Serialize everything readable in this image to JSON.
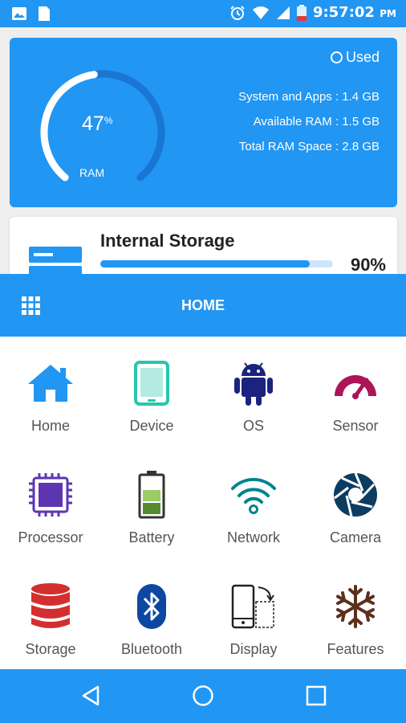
{
  "status_bar": {
    "time": "9:57:02",
    "ampm": "PM",
    "icons": [
      "image-icon",
      "document-icon",
      "alarm-icon",
      "wifi-icon",
      "signal-icon",
      "battery-charging-icon"
    ]
  },
  "ram": {
    "percent": "47",
    "percent_sign": "%",
    "label": "RAM",
    "used_fraction": 0.47,
    "legend": "Used",
    "system_apps": "System and Apps : 1.4 GB",
    "available": "Available RAM : 1.5 GB",
    "total": "Total RAM Space : 2.8 GB"
  },
  "storage": {
    "title": "Internal Storage",
    "percent_text": "90%",
    "fill_fraction": 0.9
  },
  "toolbar": {
    "title": "HOME",
    "menu_icon": "grid-icon"
  },
  "menu": {
    "items": [
      {
        "label": "Home",
        "icon": "home-icon",
        "color": "#2196f3"
      },
      {
        "label": "Device",
        "icon": "tablet-icon",
        "color": "#26c6b0"
      },
      {
        "label": "OS",
        "icon": "android-icon",
        "color": "#1a237e"
      },
      {
        "label": "Sensor",
        "icon": "gauge-icon",
        "color": "#ad1457"
      },
      {
        "label": "Processor",
        "icon": "cpu-icon",
        "color": "#5e35b1"
      },
      {
        "label": "Battery",
        "icon": "battery-icon",
        "color": "#558b2f"
      },
      {
        "label": "Network",
        "icon": "wifi-icon",
        "color": "#00838f"
      },
      {
        "label": "Camera",
        "icon": "aperture-icon",
        "color": "#0d3c61"
      },
      {
        "label": "Storage",
        "icon": "database-icon",
        "color": "#d32f2f"
      },
      {
        "label": "Bluetooth",
        "icon": "bluetooth-icon",
        "color": "#0d47a1"
      },
      {
        "label": "Display",
        "icon": "display-rotate-icon",
        "color": "#222222"
      },
      {
        "label": "Features",
        "icon": "snowflake-icon",
        "color": "#5d2f1b"
      }
    ]
  },
  "navbar": {
    "buttons": [
      "back-icon",
      "home-circle-icon",
      "recents-icon"
    ]
  },
  "colors": {
    "primary": "#2196f3",
    "gauge_dark": "#1565c0",
    "storage_track": "#cde5fb"
  }
}
